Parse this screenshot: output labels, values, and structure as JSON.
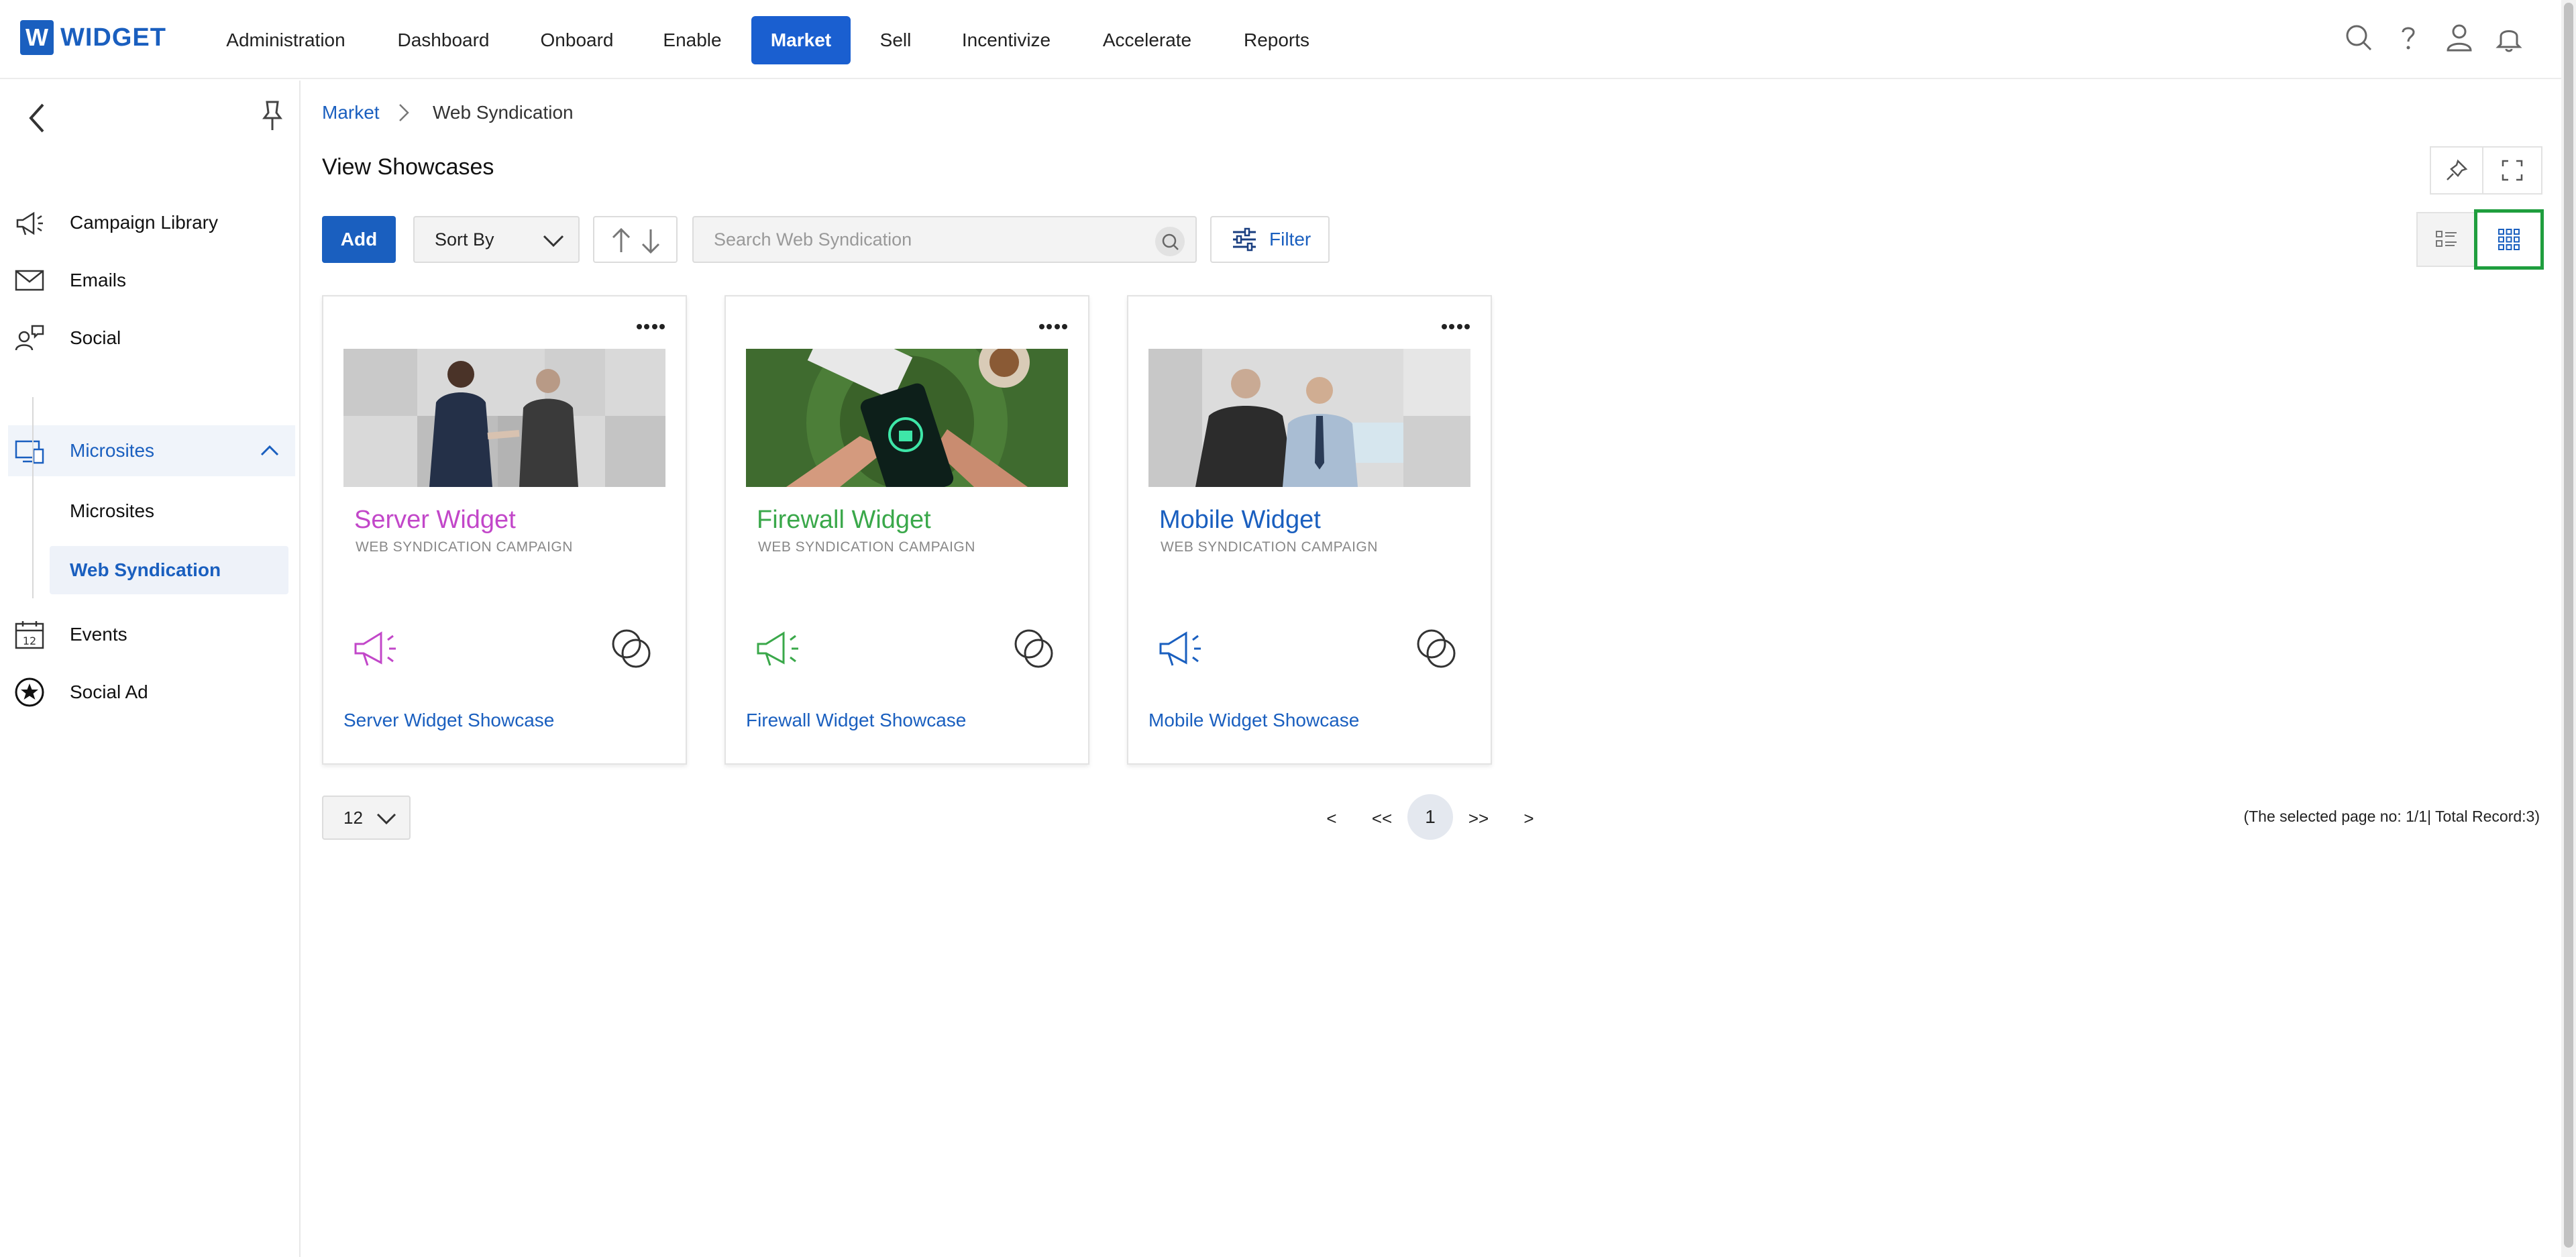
{
  "app": {
    "logo_letter": "W",
    "logo_text": "WIDGET"
  },
  "nav": {
    "items": [
      "Administration",
      "Dashboard",
      "Onboard",
      "Enable",
      "Market",
      "Sell",
      "Incentivize",
      "Accelerate",
      "Reports"
    ],
    "active": "Market"
  },
  "sidebar": {
    "items": [
      {
        "label": "Campaign Library",
        "icon": "megaphone-icon"
      },
      {
        "label": "Emails",
        "icon": "envelope-icon"
      },
      {
        "label": "Social",
        "icon": "social-icon"
      },
      {
        "label": "Microsites",
        "icon": "microsites-icon",
        "expanded": true
      },
      {
        "label": "Events",
        "icon": "calendar-icon"
      },
      {
        "label": "Social Ad",
        "icon": "star-badge-icon"
      }
    ],
    "sub_items": [
      "Microsites",
      "Web Syndication"
    ],
    "active_sub": "Web Syndication"
  },
  "breadcrumb": {
    "parent": "Market",
    "current": "Web Syndication"
  },
  "page": {
    "title": "View Showcases"
  },
  "toolbar": {
    "add_label": "Add",
    "sort_label": "Sort By",
    "search_placeholder": "Search Web Syndication",
    "filter_label": "Filter",
    "active_view": "grid"
  },
  "cards": [
    {
      "title": "Server Widget",
      "subtitle": "WEB SYNDICATION CAMPAIGN",
      "link": "Server Widget Showcase",
      "color": "#c247c9"
    },
    {
      "title": "Firewall Widget",
      "subtitle": "WEB SYNDICATION CAMPAIGN",
      "link": "Firewall Widget Showcase",
      "color": "#3aa84a"
    },
    {
      "title": "Mobile Widget",
      "subtitle": "WEB SYNDICATION CAMPAIGN",
      "link": "Mobile Widget Showcase",
      "color": "#1a5fbf"
    }
  ],
  "pager": {
    "page_size": "12",
    "prev": "<",
    "first": "<<",
    "current": "1",
    "last": ">>",
    "next": ">",
    "info": "(The selected page no: 1/1| Total Record:3)"
  },
  "colors": {
    "brand": "#1a5fbf",
    "nav_active": "#1a5fd0",
    "highlight": "#1f9e3e"
  }
}
